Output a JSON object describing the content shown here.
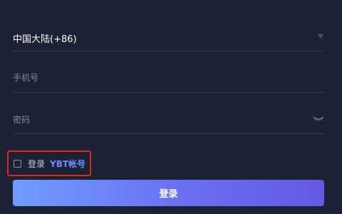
{
  "form": {
    "region": {
      "value": "中国大陆(+86)",
      "icon": "caret-down-icon"
    },
    "phone": {
      "placeholder": "手机号"
    },
    "password": {
      "placeholder": "密码",
      "icon": "eye-closed-icon"
    },
    "ybt": {
      "prefix": "登录",
      "account": "YBT帐号"
    },
    "submit_label": "登录"
  },
  "colors": {
    "background": "#1a2233",
    "divider": "#2e3a4f",
    "placeholder": "#7f8a9c",
    "link": "#6e8bff",
    "highlight_border": "#e02525",
    "button_gradient_start": "#6f9cff",
    "button_gradient_end": "#6459e6"
  }
}
